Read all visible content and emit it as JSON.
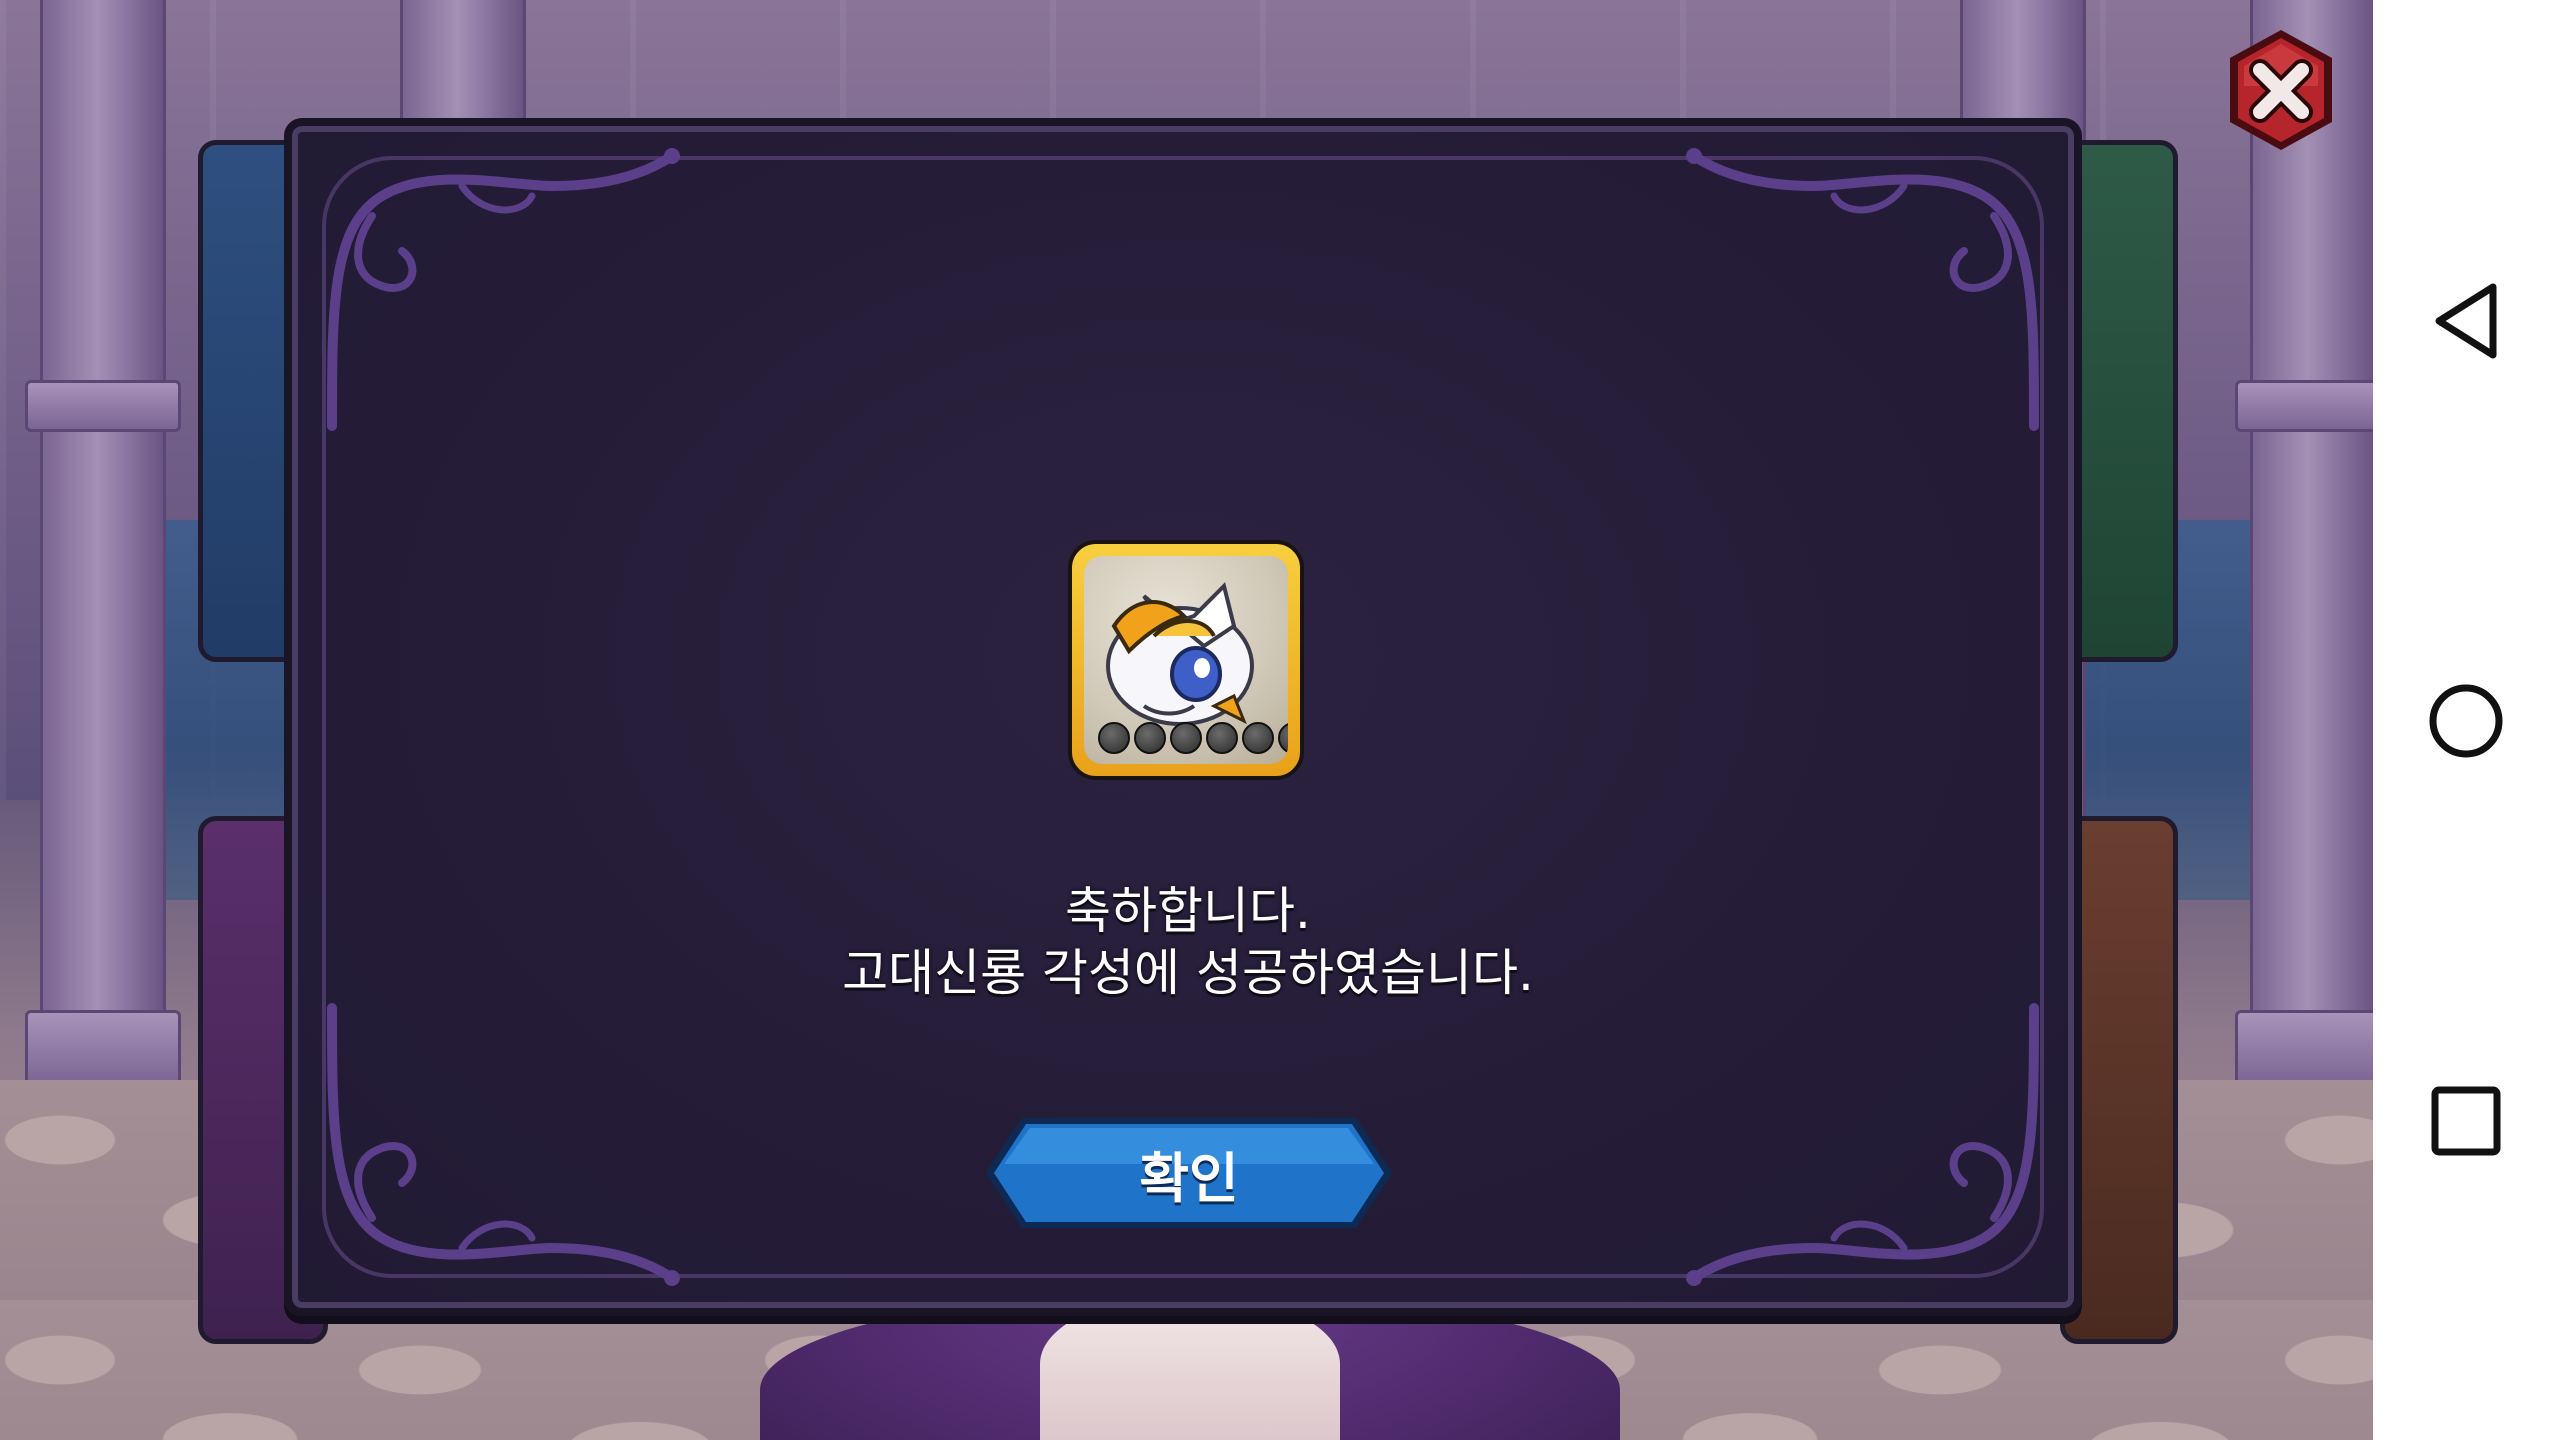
{
  "dialog": {
    "message_line1": "축하합니다.",
    "message_line2": "고대신룡 각성에 성공하였습니다.",
    "confirm_label": "확인",
    "reward_icon": "ancient-dragon-portrait-icon",
    "reward_stars_total": 6
  },
  "icons": {
    "close": "close-icon",
    "back": "back-triangle-icon",
    "home": "home-circle-icon",
    "recents": "recents-square-icon"
  },
  "colors": {
    "dialog_bg": "#251d38",
    "confirm_button": "#1f73c9",
    "close_button": "#b5252b",
    "icon_frame": "#f0b428"
  }
}
